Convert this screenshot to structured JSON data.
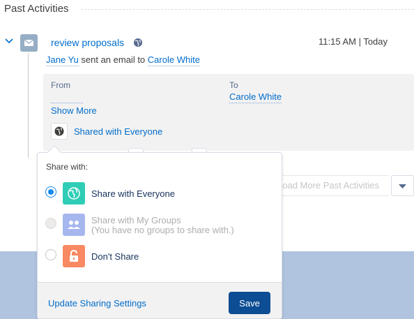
{
  "section": {
    "title": "Past Activities"
  },
  "activity": {
    "subject": "review proposals",
    "time": "11:15 AM | Today",
    "actor": "Jane Yu",
    "action": "sent an email to",
    "recipient": "Carole White",
    "details": {
      "from_label": "From",
      "to_label": "To",
      "to_value": "Carole White",
      "show_more": "Show More",
      "sharing_status": "Shared with Everyone"
    }
  },
  "load_more": {
    "label": "Load More Past Activities"
  },
  "share_popover": {
    "heading": "Share with:",
    "options": [
      {
        "label": "Share with Everyone",
        "sublabel": "",
        "selected": true,
        "disabled": false,
        "icon": "globe-icon",
        "color": "#2fcdb6"
      },
      {
        "label": "Share with My Groups",
        "sublabel": "(You have no groups to share with.)",
        "selected": false,
        "disabled": true,
        "icon": "groups-icon",
        "color": "#a6b7ef"
      },
      {
        "label": "Don't Share",
        "sublabel": "",
        "selected": false,
        "disabled": false,
        "icon": "lock-icon",
        "color": "#f88962"
      }
    ],
    "update_link": "Update Sharing Settings",
    "save_label": "Save"
  },
  "colors": {
    "link": "#006dcc",
    "brand": "#0c4d93",
    "selected_radio": "#1589ee",
    "backdrop": "#b0c4df"
  }
}
